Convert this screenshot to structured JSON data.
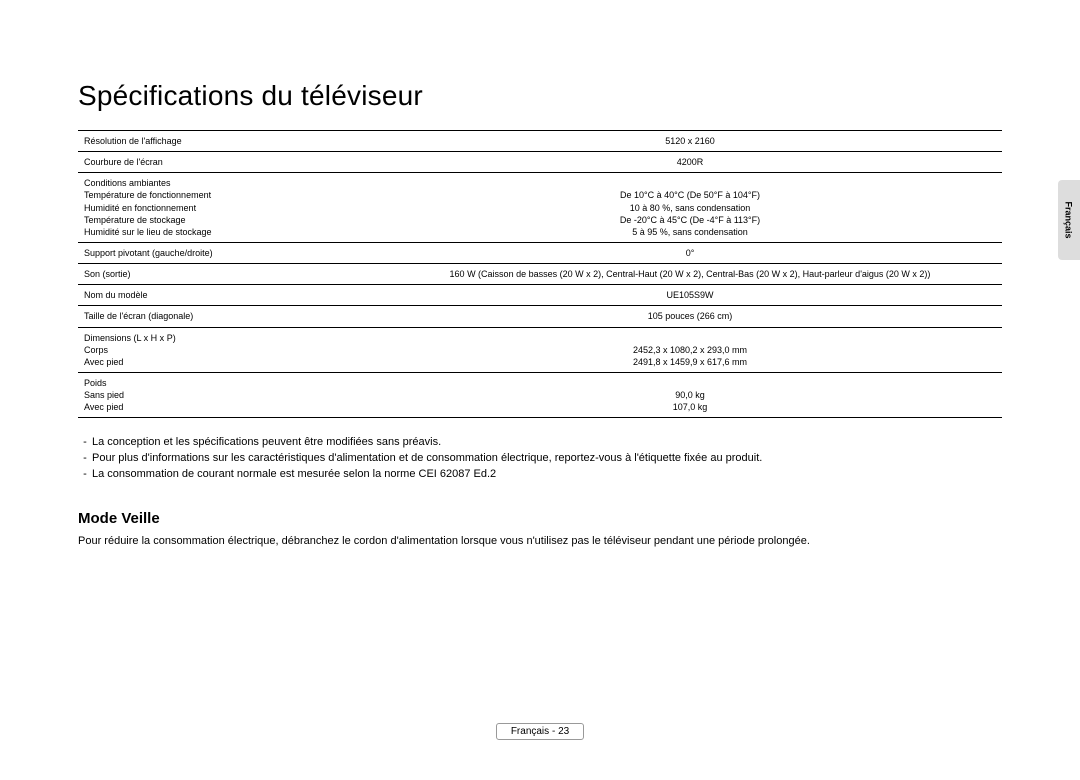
{
  "title": "Spécifications du téléviseur",
  "lang_tab": "Français",
  "rows": [
    {
      "label": "Résolution de l'affichage",
      "value": "5120 x 2160"
    },
    {
      "label": "Courbure de l'écran",
      "value": "4200R"
    },
    {
      "label": "Conditions ambiantes\nTempérature de fonctionnement\nHumidité en fonctionnement\nTempérature de stockage\nHumidité sur le lieu de stockage",
      "value": "\nDe 10°C à 40°C (De 50°F à 104°F)\n10 à 80 %, sans condensation\nDe -20°C à 45°C (De -4°F à 113°F)\n5 à 95 %, sans condensation"
    },
    {
      "label": "Support pivotant (gauche/droite)",
      "value": "0°"
    },
    {
      "label": "Son (sortie)",
      "value": "160 W (Caisson de basses (20 W x 2), Central-Haut (20 W x 2), Central-Bas (20 W x 2), Haut-parleur d'aigus (20 W x 2))"
    },
    {
      "label": "Nom du modèle",
      "value": "UE105S9W"
    },
    {
      "label": "Taille de l'écran (diagonale)",
      "value": "105 pouces (266 cm)"
    },
    {
      "label": "Dimensions (L x H x P)\nCorps\nAvec pied",
      "value": "\n2452,3 x 1080,2 x 293,0 mm\n2491,8 x 1459,9 x 617,6 mm"
    },
    {
      "label": "Poids\nSans pied\nAvec pied",
      "value": "\n90,0 kg\n107,0 kg"
    }
  ],
  "notes": [
    "La conception et les spécifications peuvent être modifiées sans préavis.",
    "Pour plus d'informations sur les caractéristiques d'alimentation et de consommation électrique, reportez-vous à l'étiquette fixée au produit.",
    "La consommation de courant normale est mesurée selon la norme CEI 62087 Ed.2"
  ],
  "subheading": "Mode Veille",
  "body": "Pour réduire la consommation électrique, débranchez le cordon d'alimentation lorsque vous n'utilisez pas le téléviseur pendant une période prolongée.",
  "footer_lang": "Français",
  "footer_sep": " - ",
  "footer_page": "23"
}
